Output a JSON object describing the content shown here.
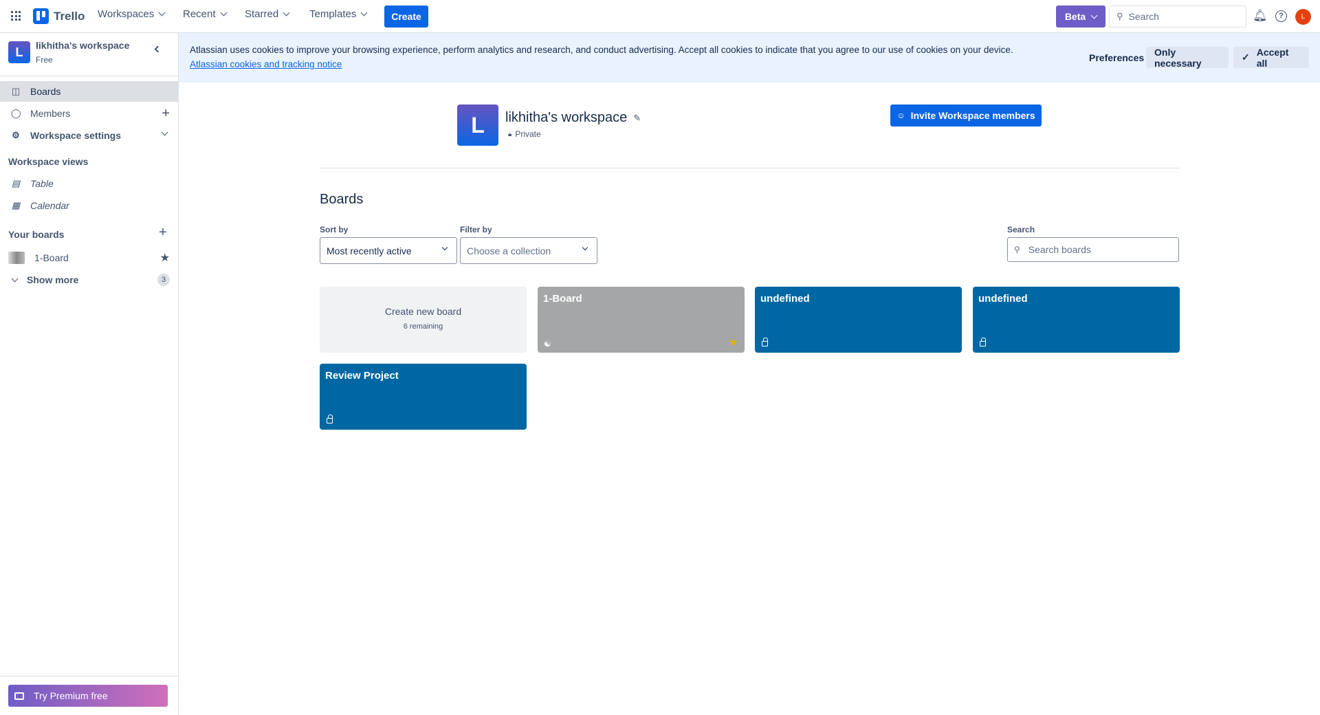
{
  "topbar": {
    "brand": "Trello",
    "nav": [
      "Workspaces",
      "Recent",
      "Starred",
      "Templates"
    ],
    "create": "Create",
    "beta": "Beta",
    "search_placeholder": "Search",
    "avatar_initial": "L"
  },
  "sidebar": {
    "workspace_initial": "L",
    "workspace_name": "likhitha's workspace",
    "plan": "Free",
    "items": [
      {
        "label": "Boards"
      },
      {
        "label": "Members"
      },
      {
        "label": "Workspace settings"
      }
    ],
    "views_heading": "Workspace views",
    "views": [
      {
        "label": "Table"
      },
      {
        "label": "Calendar"
      }
    ],
    "your_boards_heading": "Your boards",
    "boards": [
      {
        "label": "1-Board"
      }
    ],
    "show_more": "Show more",
    "show_more_count": "3",
    "premium": "Try Premium free"
  },
  "cookie": {
    "text": "Atlassian uses cookies to improve your browsing experience, perform analytics and research, and conduct advertising. Accept all cookies to indicate that you agree to our use of cookies on your device.",
    "link": "Atlassian cookies and tracking notice",
    "preferences": "Preferences",
    "only_necessary": "Only necessary",
    "accept_all": "Accept all"
  },
  "workspace": {
    "initial": "L",
    "name": "likhitha's workspace",
    "visibility": "Private",
    "invite": "Invite Workspace members"
  },
  "boards_section": {
    "heading": "Boards",
    "sort_label": "Sort by",
    "sort_value": "Most recently active",
    "filter_label": "Filter by",
    "filter_placeholder": "Choose a collection",
    "search_label": "Search",
    "search_placeholder": "Search boards",
    "create_label": "Create new board",
    "create_remaining": "6 remaining",
    "cards": [
      {
        "title": "1-Board",
        "color": "#a5a6a8",
        "starred": true
      },
      {
        "title": "undefined",
        "color": "#0067a3"
      },
      {
        "title": "undefined",
        "color": "#0067a3"
      },
      {
        "title": "Review Project",
        "color": "#0067a3"
      }
    ]
  }
}
